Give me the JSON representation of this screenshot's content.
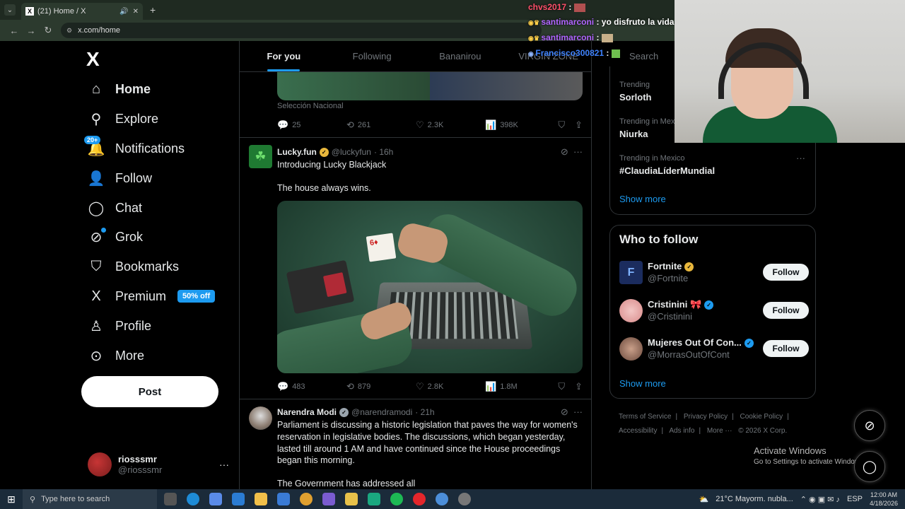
{
  "browser": {
    "tab_title": "(21) Home / X",
    "tab_favicon": "X",
    "url": "x.com/home",
    "new_tab": "+"
  },
  "sidebar": {
    "logo": "X",
    "items": [
      {
        "label": "Home",
        "icon": "home-icon",
        "glyph": "⌂"
      },
      {
        "label": "Explore",
        "icon": "search-icon",
        "glyph": "⚲"
      },
      {
        "label": "Notifications",
        "icon": "bell-icon",
        "glyph": "🔔",
        "badge": "20+"
      },
      {
        "label": "Follow",
        "icon": "add-person-icon",
        "glyph": "👤"
      },
      {
        "label": "Chat",
        "icon": "chat-icon",
        "glyph": "◯"
      },
      {
        "label": "Grok",
        "icon": "grok-icon",
        "glyph": "⊘"
      },
      {
        "label": "Bookmarks",
        "icon": "bookmark-icon",
        "glyph": "⛉"
      },
      {
        "label": "Premium",
        "icon": "x-logo-icon",
        "glyph": "X",
        "tag": "50% off"
      },
      {
        "label": "Profile",
        "icon": "profile-icon",
        "glyph": "♙"
      },
      {
        "label": "More",
        "icon": "more-circle-icon",
        "glyph": "⊙"
      }
    ],
    "post_button": "Post",
    "user": {
      "name": "riosssmr",
      "handle": "@riosssmr",
      "more": "···"
    }
  },
  "feed": {
    "tabs": [
      "For you",
      "Following",
      "Bananirou",
      "VIRGIN ZONE"
    ],
    "prev_post": {
      "caption": "Selección Nacional",
      "replies": "25",
      "reposts": "261",
      "likes": "2.3K",
      "views": "398K"
    },
    "posts": [
      {
        "name": "Lucky.fun",
        "handle": "@luckyfun",
        "time": "· 16h",
        "text1": "Introducing Lucky Blackjack",
        "text2": "The house always wins.",
        "replies": "483",
        "reposts": "879",
        "likes": "2.8K",
        "views": "1.8M"
      },
      {
        "name": "Narendra Modi",
        "handle": "@narendramodi",
        "time": "· 21h",
        "text1": "Parliament is discussing a historic legislation that paves the way for women's reservation in legislative bodies. The discussions, which began yesterday, lasted till around 1 AM and have continued since the House proceedings began this morning.",
        "text2": "The Government has addressed all"
      }
    ]
  },
  "right": {
    "search_placeholder": "Search",
    "trends": [
      {
        "context": "Trending",
        "topic": "Sorloth"
      },
      {
        "context": "Trending in Mex",
        "topic": "Niurka"
      },
      {
        "context": "Trending in Mexico",
        "topic": "#ClaudiaLíderMundial"
      }
    ],
    "trends_show_more": "Show more",
    "who_to_follow": {
      "title": "Who to follow",
      "users": [
        {
          "name": "Fortnite",
          "handle": "@Fortnite",
          "button": "Follow",
          "badge_color": "#e8b73c"
        },
        {
          "name": "Cristinini 🎀",
          "handle": "@Cristinini",
          "button": "Follow",
          "badge_color": "#1d9bf0"
        },
        {
          "name": "Mujeres Out Of Con...",
          "handle": "@MorrasOutOfCont",
          "button": "Follow",
          "badge_color": "#1d9bf0"
        }
      ],
      "show_more": "Show more"
    },
    "footer": [
      "Terms of Service",
      "|",
      "Privacy Policy",
      "|",
      "Cookie Policy",
      "|",
      "Accessibility",
      "|",
      "Ads info",
      "|",
      "More ···",
      "© 2026 X Corp."
    ],
    "activate": {
      "title": "Activate Windows",
      "sub": "Go to Settings to activate Windows."
    }
  },
  "stream_chat": [
    {
      "user": "chvs2017",
      "msg": "",
      "color": "#ff4f6a"
    },
    {
      "user": "santimarconi",
      "msg": "yo disfruto la vida",
      "color": "#b065ff"
    },
    {
      "user": "santimarconi",
      "msg": "",
      "color": "#b065ff"
    },
    {
      "user": "Francisco300821",
      "msg": "",
      "color": "#3f83ff"
    }
  ],
  "taskbar": {
    "search_placeholder": "Type here to search",
    "weather": "21°C  Mayorm. nubla...",
    "lang": "ESP",
    "time": "12:00 AM",
    "date": "4/18/2026"
  },
  "colors": {
    "accent": "#1d9bf0",
    "background": "#000000",
    "border": "#2f3336",
    "muted": "#71767b"
  }
}
